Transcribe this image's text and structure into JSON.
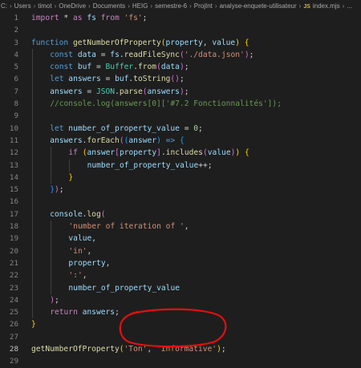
{
  "breadcrumb": {
    "items": [
      "C:",
      "Users",
      "timot",
      "OneDrive",
      "Documents",
      "HEIG",
      "semestre-6",
      "ProjInt",
      "analyse-enquete-utilisateur"
    ],
    "file_icon": "JS",
    "file_name": "index.mjs",
    "trailing": "..."
  },
  "editor": {
    "active_line": 28,
    "annotation": "red-circle-around-arguments",
    "lines": [
      {
        "n": "1",
        "tokens": [
          [
            "kw2",
            "import"
          ],
          [
            "punc",
            " * "
          ],
          [
            "kw2",
            "as"
          ],
          [
            "var",
            " fs "
          ],
          [
            "kw2",
            "from"
          ],
          [
            "punc",
            " "
          ],
          [
            "str",
            "'fs'"
          ],
          [
            "punc",
            ";"
          ]
        ]
      },
      {
        "n": "2",
        "tokens": []
      },
      {
        "n": "3",
        "tokens": [
          [
            "kw",
            "function"
          ],
          [
            "punc",
            " "
          ],
          [
            "fn",
            "getNumberOfProperty"
          ],
          [
            "br1",
            "("
          ],
          [
            "var",
            "property"
          ],
          [
            "punc",
            ", "
          ],
          [
            "var",
            "value"
          ],
          [
            "br1",
            ")"
          ],
          [
            "punc",
            " "
          ],
          [
            "br1",
            "{"
          ]
        ]
      },
      {
        "n": "4",
        "indent": 1,
        "tokens": [
          [
            "kw",
            "const"
          ],
          [
            "punc",
            " "
          ],
          [
            "var",
            "data"
          ],
          [
            "punc",
            " = "
          ],
          [
            "var",
            "fs"
          ],
          [
            "punc",
            "."
          ],
          [
            "fn",
            "readFileSync"
          ],
          [
            "br2",
            "("
          ],
          [
            "str",
            "'./data.json'"
          ],
          [
            "br2",
            ")"
          ],
          [
            "punc",
            ";"
          ]
        ]
      },
      {
        "n": "5",
        "indent": 1,
        "tokens": [
          [
            "kw",
            "const"
          ],
          [
            "punc",
            " "
          ],
          [
            "var",
            "buf"
          ],
          [
            "punc",
            " = "
          ],
          [
            "cls",
            "Buffer"
          ],
          [
            "punc",
            "."
          ],
          [
            "fn",
            "from"
          ],
          [
            "br2",
            "("
          ],
          [
            "var",
            "data"
          ],
          [
            "br2",
            ")"
          ],
          [
            "punc",
            ";"
          ]
        ]
      },
      {
        "n": "6",
        "indent": 1,
        "tokens": [
          [
            "kw",
            "let"
          ],
          [
            "punc",
            " "
          ],
          [
            "var",
            "answers"
          ],
          [
            "punc",
            " = "
          ],
          [
            "var",
            "buf"
          ],
          [
            "punc",
            "."
          ],
          [
            "fn",
            "toString"
          ],
          [
            "br2",
            "()"
          ],
          [
            "punc",
            ";"
          ]
        ]
      },
      {
        "n": "7",
        "indent": 1,
        "tokens": [
          [
            "var",
            "answers"
          ],
          [
            "punc",
            " = "
          ],
          [
            "cls",
            "JSON"
          ],
          [
            "punc",
            "."
          ],
          [
            "fn",
            "parse"
          ],
          [
            "br2",
            "("
          ],
          [
            "var",
            "answers"
          ],
          [
            "br2",
            ")"
          ],
          [
            "punc",
            ";"
          ]
        ]
      },
      {
        "n": "8",
        "indent": 1,
        "tokens": [
          [
            "cmt",
            "//console.log(answers[0]['#7.2 Fonctionnalités']);"
          ]
        ]
      },
      {
        "n": "9",
        "indent": 1,
        "tokens": []
      },
      {
        "n": "10",
        "indent": 1,
        "tokens": [
          [
            "kw",
            "let"
          ],
          [
            "punc",
            " "
          ],
          [
            "var",
            "number_of_property_value"
          ],
          [
            "punc",
            " = "
          ],
          [
            "num",
            "0"
          ],
          [
            "punc",
            ";"
          ]
        ]
      },
      {
        "n": "11",
        "indent": 1,
        "tokens": [
          [
            "var",
            "answers"
          ],
          [
            "punc",
            "."
          ],
          [
            "fn",
            "forEach"
          ],
          [
            "br2",
            "("
          ],
          [
            "br3",
            "("
          ],
          [
            "var",
            "answer"
          ],
          [
            "br3",
            ")"
          ],
          [
            "punc",
            " "
          ],
          [
            "kw",
            "=>"
          ],
          [
            "punc",
            " "
          ],
          [
            "br3",
            "{"
          ]
        ]
      },
      {
        "n": "12",
        "indent": 2,
        "tokens": [
          [
            "kw2",
            "if"
          ],
          [
            "punc",
            " "
          ],
          [
            "br1",
            "("
          ],
          [
            "var",
            "answer"
          ],
          [
            "br2",
            "["
          ],
          [
            "var",
            "property"
          ],
          [
            "br2",
            "]"
          ],
          [
            "punc",
            "."
          ],
          [
            "fn",
            "includes"
          ],
          [
            "br2",
            "("
          ],
          [
            "var",
            "value"
          ],
          [
            "br2",
            ")"
          ],
          [
            "br1",
            ")"
          ],
          [
            "punc",
            " "
          ],
          [
            "br1",
            "{"
          ]
        ]
      },
      {
        "n": "13",
        "indent": 3,
        "tokens": [
          [
            "var",
            "number_of_property_value"
          ],
          [
            "punc",
            "++;"
          ]
        ]
      },
      {
        "n": "14",
        "indent": 2,
        "tokens": [
          [
            "br1",
            "}"
          ]
        ]
      },
      {
        "n": "15",
        "indent": 1,
        "tokens": [
          [
            "br3",
            "}"
          ],
          [
            "br2",
            ")"
          ],
          [
            "punc",
            ";"
          ]
        ]
      },
      {
        "n": "16",
        "indent": 1,
        "tokens": []
      },
      {
        "n": "17",
        "indent": 1,
        "tokens": [
          [
            "var",
            "console"
          ],
          [
            "punc",
            "."
          ],
          [
            "fn",
            "log"
          ],
          [
            "br2",
            "("
          ]
        ]
      },
      {
        "n": "18",
        "indent": 2,
        "tokens": [
          [
            "str",
            "'number of iteration of '"
          ],
          [
            "punc",
            ","
          ]
        ]
      },
      {
        "n": "19",
        "indent": 2,
        "tokens": [
          [
            "var",
            "value"
          ],
          [
            "punc",
            ","
          ]
        ]
      },
      {
        "n": "20",
        "indent": 2,
        "tokens": [
          [
            "str",
            "'in'"
          ],
          [
            "punc",
            ","
          ]
        ]
      },
      {
        "n": "21",
        "indent": 2,
        "tokens": [
          [
            "var",
            "property"
          ],
          [
            "punc",
            ","
          ]
        ]
      },
      {
        "n": "22",
        "indent": 2,
        "tokens": [
          [
            "str",
            "':'"
          ],
          [
            "punc",
            ","
          ]
        ]
      },
      {
        "n": "23",
        "indent": 2,
        "tokens": [
          [
            "var",
            "number_of_property_value"
          ]
        ]
      },
      {
        "n": "24",
        "indent": 1,
        "tokens": [
          [
            "br2",
            ")"
          ],
          [
            "punc",
            ";"
          ]
        ]
      },
      {
        "n": "25",
        "indent": 1,
        "tokens": [
          [
            "kw2",
            "return"
          ],
          [
            "punc",
            " "
          ],
          [
            "var",
            "answers"
          ],
          [
            "punc",
            ";"
          ]
        ]
      },
      {
        "n": "26",
        "tokens": [
          [
            "br1",
            "}"
          ]
        ]
      },
      {
        "n": "27",
        "tokens": []
      },
      {
        "n": "28",
        "tokens": [
          [
            "fn",
            "getNumberOfProperty"
          ],
          [
            "br1",
            "("
          ],
          [
            "str",
            "'Ton'"
          ],
          [
            "punc",
            ", "
          ],
          [
            "str",
            "'Informative'"
          ],
          [
            "br1",
            ")"
          ],
          [
            "punc",
            ";"
          ]
        ]
      },
      {
        "n": "29",
        "tokens": []
      }
    ]
  }
}
